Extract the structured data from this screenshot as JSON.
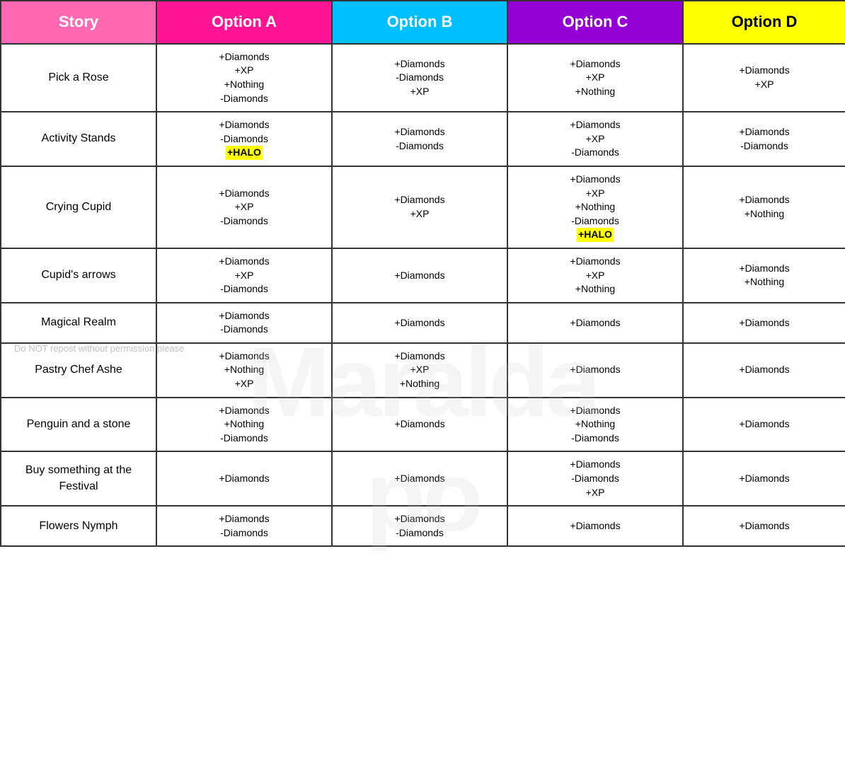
{
  "header": {
    "story_label": "Story",
    "option_a_label": "Option A",
    "option_b_label": "Option B",
    "option_c_label": "Option C",
    "option_d_label": "Option D"
  },
  "watermark": "Maralda",
  "watermark2": "po",
  "copyright": "Do NOT repost without permission please",
  "rows": [
    {
      "story": "Pick a Rose",
      "option_a": "+Diamonds\n+XP\n+Nothing\n-Diamonds",
      "option_b": "+Diamonds\n-Diamonds\n+XP",
      "option_c": "+Diamonds\n+XP\n+Nothing",
      "option_d": "+Diamonds\n+XP",
      "a_halo": false,
      "c_halo": false
    },
    {
      "story": "Activity Stands",
      "option_a": "+Diamonds\n-Diamonds\n+HALO",
      "option_b": "+Diamonds\n-Diamonds",
      "option_c": "+Diamonds\n+XP\n-Diamonds",
      "option_d": "+Diamonds\n-Diamonds",
      "a_halo": true,
      "c_halo": false
    },
    {
      "story": "Crying Cupid",
      "option_a": "+Diamonds\n+XP\n-Diamonds",
      "option_b": "+Diamonds\n+XP",
      "option_c": "+Diamonds\n+XP\n+Nothing\n-Diamonds\n+HALO",
      "option_d": "+Diamonds\n+Nothing",
      "a_halo": false,
      "c_halo": true
    },
    {
      "story": "Cupid's arrows",
      "option_a": "+Diamonds\n+XP\n-Diamonds",
      "option_b": "+Diamonds",
      "option_c": "+Diamonds\n+XP\n+Nothing",
      "option_d": "+Diamonds\n+Nothing",
      "a_halo": false,
      "c_halo": false
    },
    {
      "story": "Magical Realm",
      "option_a": "+Diamonds\n-Diamonds",
      "option_b": "+Diamonds",
      "option_c": "+Diamonds",
      "option_d": "+Diamonds",
      "a_halo": false,
      "c_halo": false
    },
    {
      "story": "Pastry Chef Ashe",
      "option_a": "+Diamonds\n+Nothing\n+XP",
      "option_b": "+Diamonds\n+XP\n+Nothing",
      "option_c": "+Diamonds",
      "option_d": "+Diamonds",
      "a_halo": false,
      "c_halo": false
    },
    {
      "story": "Penguin and a stone",
      "option_a": "+Diamonds\n+Nothing\n-Diamonds",
      "option_b": "+Diamonds",
      "option_c": "+Diamonds\n+Nothing\n-Diamonds",
      "option_d": "+Diamonds",
      "a_halo": false,
      "c_halo": false
    },
    {
      "story": "Buy something at the Festival",
      "option_a": "+Diamonds",
      "option_b": "+Diamonds",
      "option_c": "+Diamonds\n-Diamonds\n+XP",
      "option_d": "+Diamonds",
      "a_halo": false,
      "c_halo": false
    },
    {
      "story": "Flowers Nymph",
      "option_a": "+Diamonds\n-Diamonds",
      "option_b": "+Diamonds\n-Diamonds",
      "option_c": "+Diamonds",
      "option_d": "+Diamonds",
      "a_halo": false,
      "c_halo": false
    }
  ]
}
